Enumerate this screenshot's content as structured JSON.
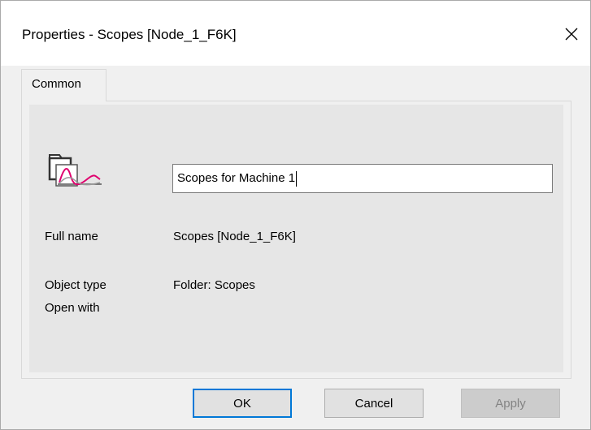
{
  "window": {
    "title": "Properties - Scopes [Node_1_F6K]",
    "close_glyph": "✕"
  },
  "tabs": [
    {
      "label": "Common",
      "selected": true
    }
  ],
  "general": {
    "object_icon": "scope-folder-icon",
    "name_value": "Scopes for Machine 1",
    "full_name_label": "Full name",
    "full_name_value": "Scopes [Node_1_F6K]",
    "object_type_label": "Object type",
    "object_type_value": "Folder: Scopes",
    "open_with_label": "Open with",
    "open_with_value": ""
  },
  "buttons": {
    "ok": "OK",
    "cancel": "Cancel",
    "apply": "Apply",
    "apply_enabled": false
  },
  "colors": {
    "accent": "#0078d7",
    "scope_curve": "#e0006e"
  }
}
